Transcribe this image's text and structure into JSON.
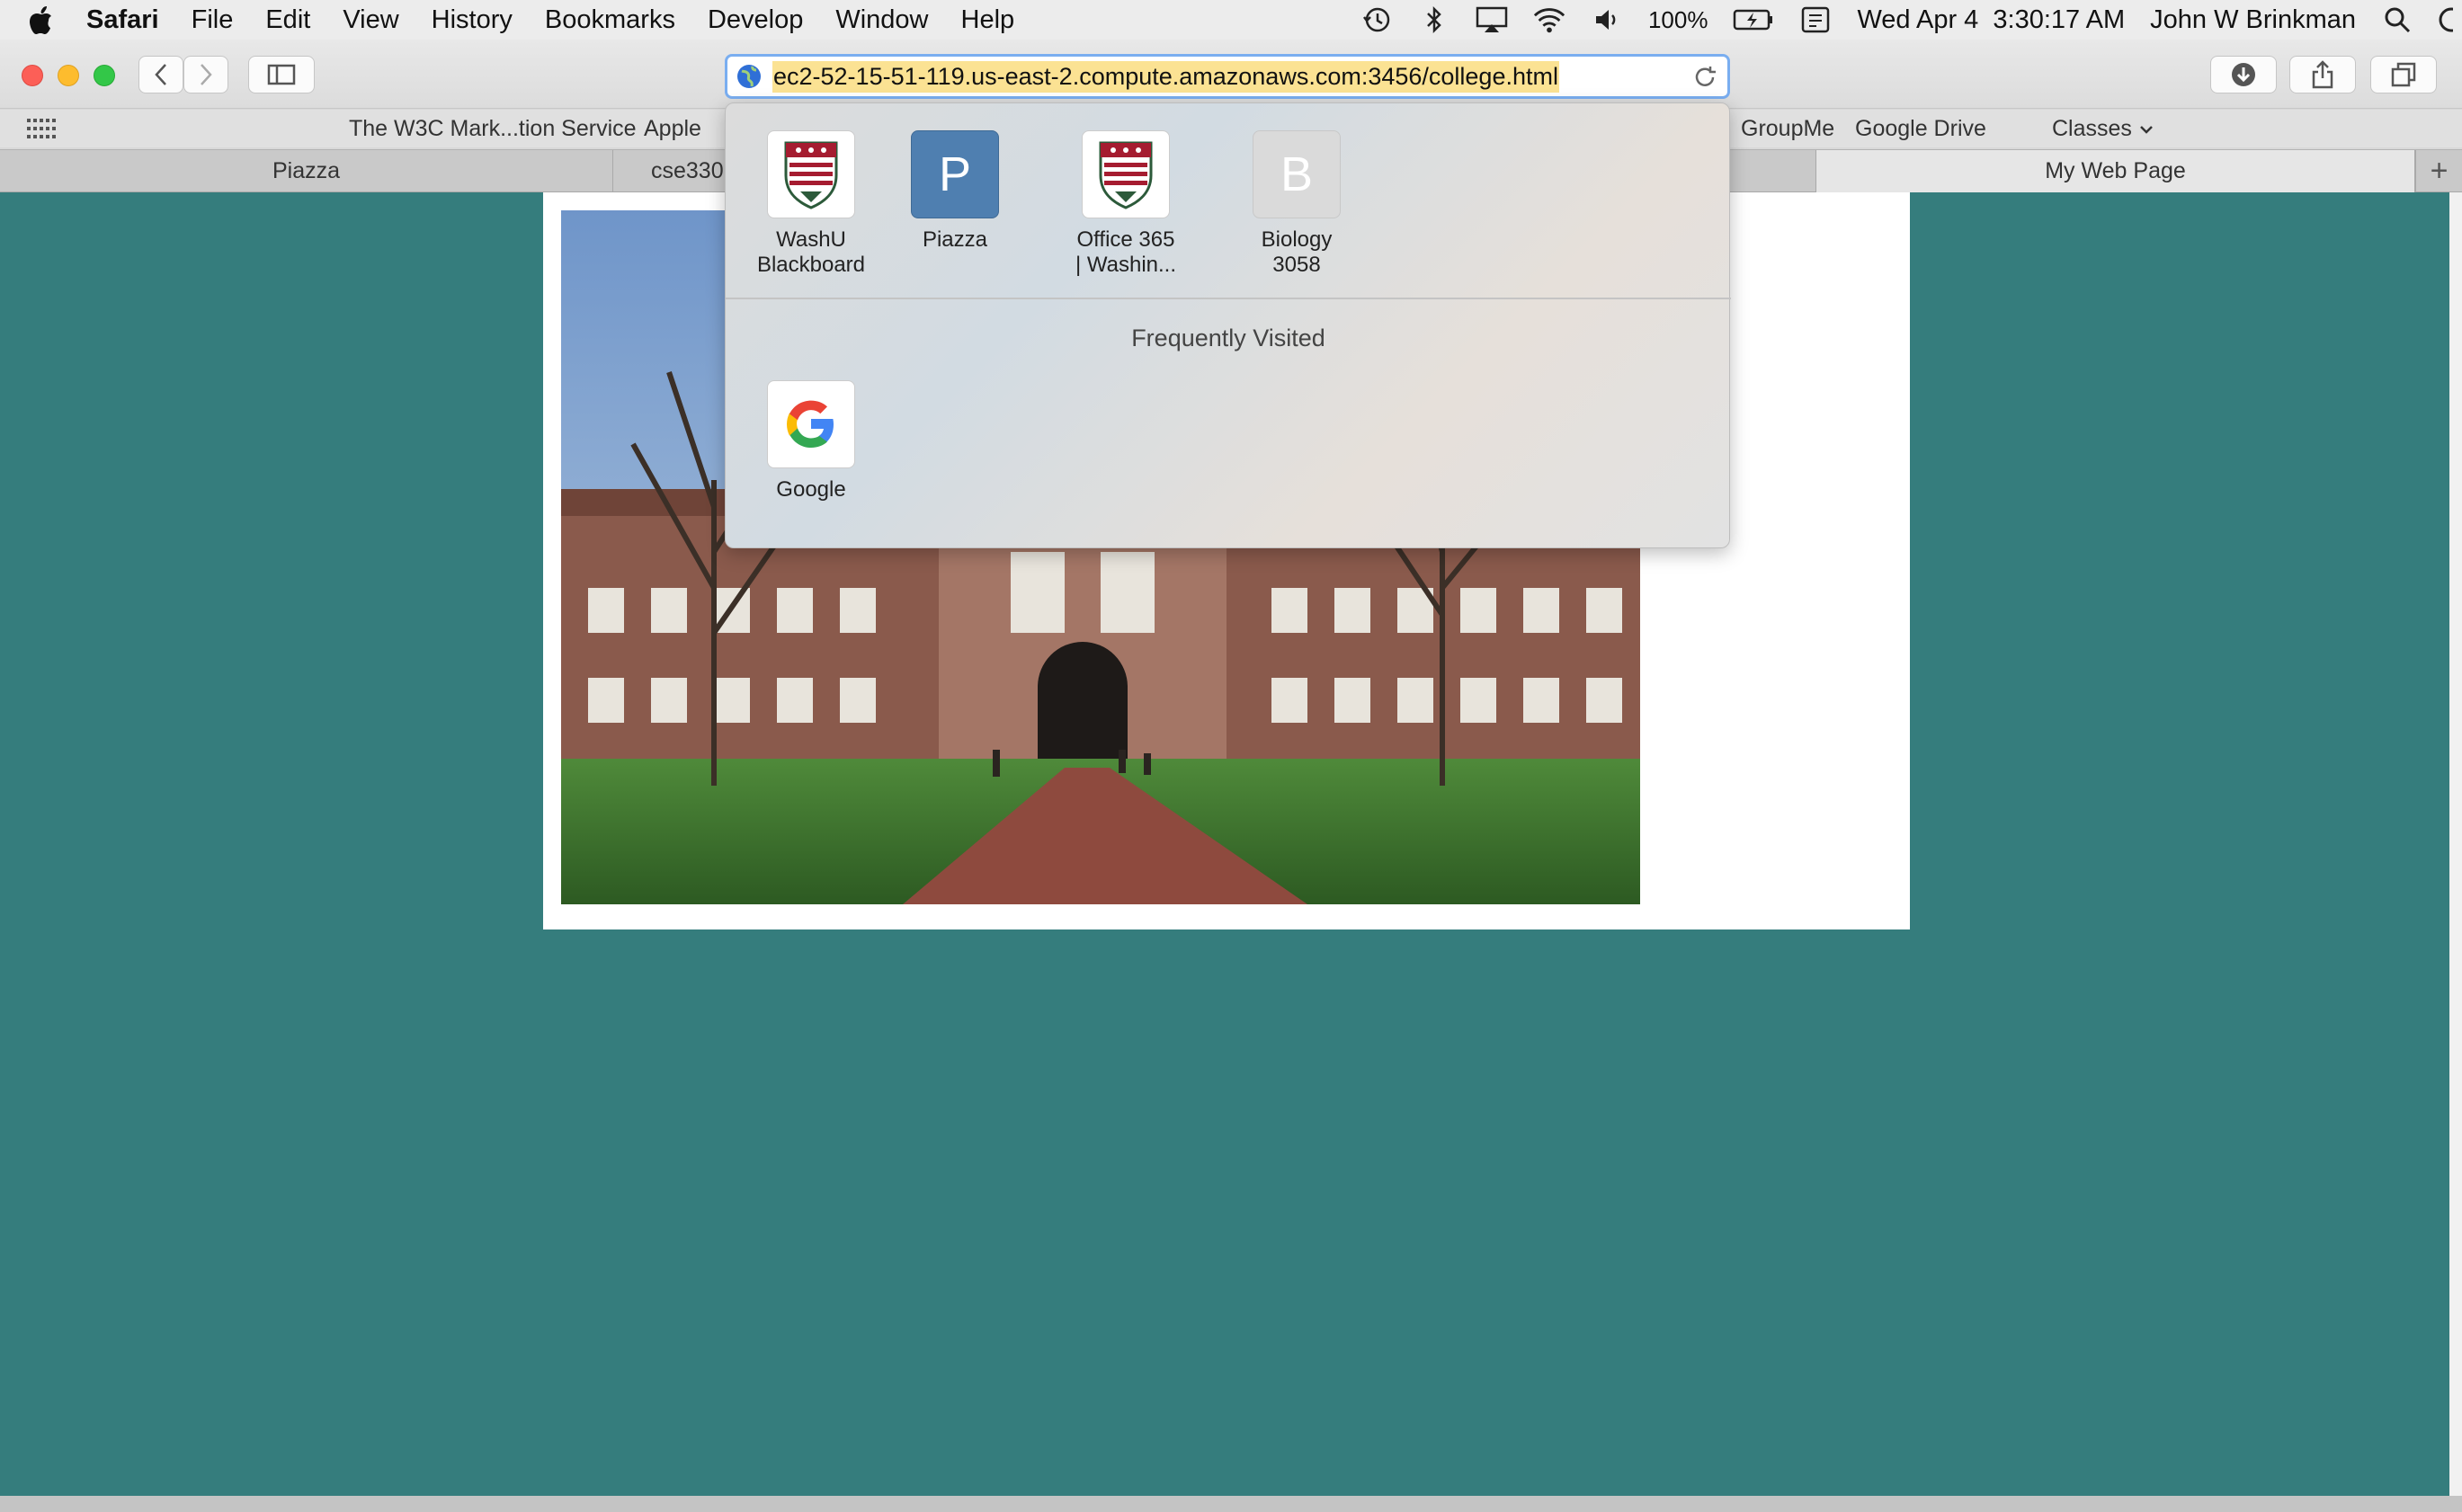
{
  "menubar": {
    "app": "Safari",
    "items": [
      "File",
      "Edit",
      "View",
      "History",
      "Bookmarks",
      "Develop",
      "Window",
      "Help"
    ],
    "battery": "100%",
    "datetime": "Wed Apr 4  3:30:17 AM",
    "user": "John W Brinkman"
  },
  "toolbar": {
    "url": "ec2-52-15-51-119.us-east-2.compute.amazonaws.com:3456/college.html"
  },
  "favorites_bar": {
    "items": [
      "The W3C Mark...tion Service",
      "Apple",
      "GroupMe",
      "Google Drive",
      "Classes"
    ]
  },
  "tabs": [
    {
      "label": "Piazza"
    },
    {
      "label": "cse330"
    },
    {
      "label": "My Web Page"
    }
  ],
  "dropdown": {
    "favorites": [
      {
        "line1": "WashU",
        "line2": "Blackboard",
        "icon": "washu-crest-icon"
      },
      {
        "line1": "Piazza",
        "line2": "",
        "icon": "letter-p-icon",
        "letter": "P"
      },
      {
        "line1": "Office 365",
        "line2": "| Washin...",
        "icon": "washu-crest-icon"
      },
      {
        "line1": "Biology",
        "line2": "3058",
        "icon": "letter-b-icon",
        "letter": "B"
      }
    ],
    "frequently_visited_title": "Frequently Visited",
    "frequently_visited": [
      {
        "label": "Google",
        "icon": "google-g-icon"
      }
    ]
  },
  "colors": {
    "page_background": "#357d7d",
    "url_highlight": "#fbe293",
    "piazza_tile": "#4f7fb0"
  }
}
